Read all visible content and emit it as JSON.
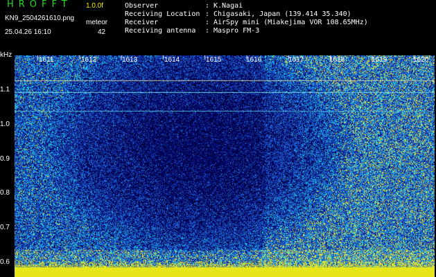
{
  "header": {
    "app_title": "HROFFT",
    "version": "1.0.0f",
    "filename": "KN9_2504261610.png",
    "meteor_label": "meteor",
    "datetime": "25.04.26 16:10",
    "meteor_count": "42"
  },
  "station_info": [
    {
      "label": "Observer",
      "value": "K.Nagai"
    },
    {
      "label": "Receiving Location",
      "value": "Chigasaki, Japan (139.414 35.340)"
    },
    {
      "label": "Receiver",
      "value": "AirSpy mini (Miakejima VOR 108.65MHz)"
    },
    {
      "label": "Receiving antenna",
      "value": "Maspro FM-3"
    }
  ],
  "spectrogram": {
    "y_unit": "kHz",
    "x_ticks": [
      "1611",
      "1612",
      "1613",
      "1614",
      "1615",
      "1616",
      "1617",
      "1618",
      "1619",
      "1620"
    ],
    "y_ticks": [
      "1.1",
      "1.0",
      "0.9",
      "0.8",
      "0.7",
      "0.6"
    ],
    "colors": {
      "background": "#000000",
      "noise_low": "#0a1a8c",
      "noise_mid": "#1f6fe0",
      "noise_high": "#22d7e6",
      "signal": "#e6e633",
      "title": "#29d629"
    }
  }
}
